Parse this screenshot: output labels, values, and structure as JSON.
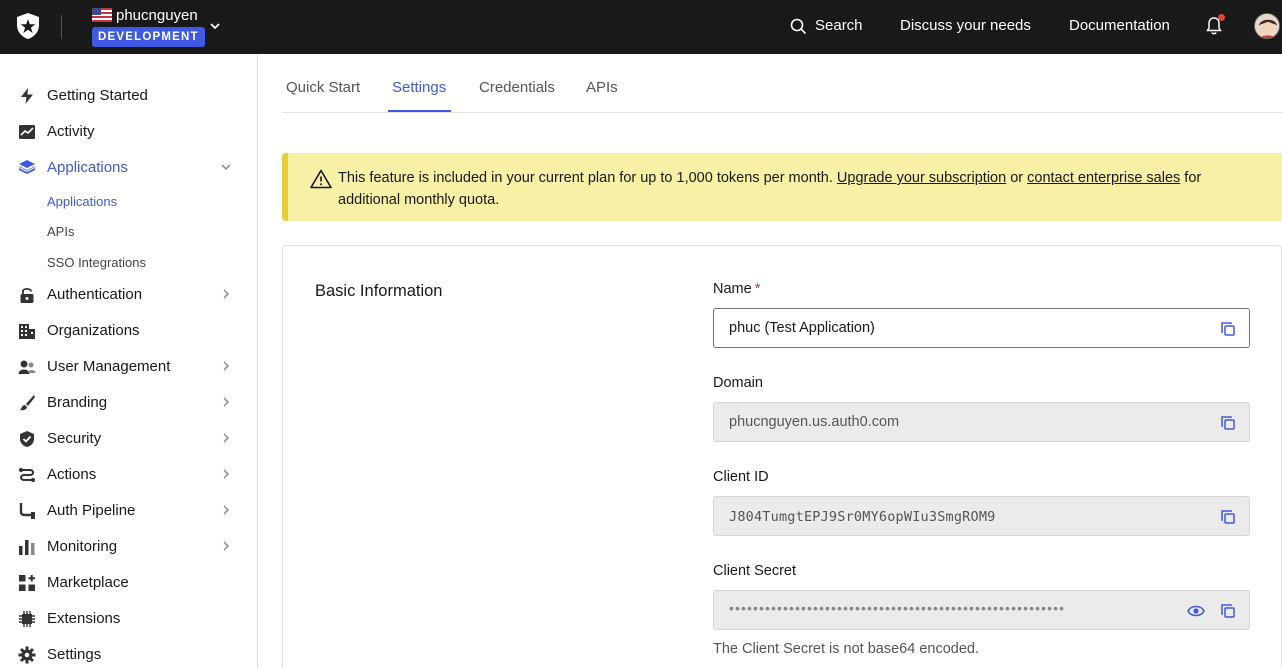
{
  "topbar": {
    "tenant_name": "phucnguyen",
    "env_badge": "DEVELOPMENT",
    "search_label": "Search",
    "discuss_label": "Discuss your needs",
    "docs_label": "Documentation"
  },
  "sidebar": {
    "items": [
      {
        "label": "Getting Started",
        "icon": "bolt-icon"
      },
      {
        "label": "Activity",
        "icon": "activity-chart-icon"
      },
      {
        "label": "Applications",
        "icon": "layers-icon"
      },
      {
        "label": "Authentication",
        "icon": "lock-icon"
      },
      {
        "label": "Organizations",
        "icon": "building-icon"
      },
      {
        "label": "User Management",
        "icon": "users-icon"
      },
      {
        "label": "Branding",
        "icon": "brush-icon"
      },
      {
        "label": "Security",
        "icon": "shield-check-icon"
      },
      {
        "label": "Actions",
        "icon": "flow-icon"
      },
      {
        "label": "Auth Pipeline",
        "icon": "pipeline-icon"
      },
      {
        "label": "Monitoring",
        "icon": "bar-chart-icon"
      },
      {
        "label": "Marketplace",
        "icon": "grid-plus-icon"
      },
      {
        "label": "Extensions",
        "icon": "chip-icon"
      },
      {
        "label": "Settings",
        "icon": "gear-icon"
      }
    ],
    "sub_items": [
      {
        "label": "Applications"
      },
      {
        "label": "APIs"
      },
      {
        "label": "SSO Integrations"
      }
    ]
  },
  "tabs": [
    {
      "label": "Quick Start"
    },
    {
      "label": "Settings"
    },
    {
      "label": "Credentials"
    },
    {
      "label": "APIs"
    }
  ],
  "banner": {
    "text_before": "This feature is included in your current plan for up to 1,000 tokens per month. ",
    "link1": "Upgrade your subscription",
    "text_mid": " or ",
    "link2": "contact enterprise sales",
    "text_after": " for additional monthly quota."
  },
  "basic_info": {
    "section_title": "Basic Information",
    "name_label": "Name",
    "name_value": "phuc (Test Application)",
    "domain_label": "Domain",
    "domain_value": "phucnguyen.us.auth0.com",
    "client_id_label": "Client ID",
    "client_id_value": "J804TumgtEPJ9Sr0MY6opWIu3SmgROM9",
    "client_secret_label": "Client Secret",
    "client_secret_masked": "••••••••••••••••••••••••••••••••••••••••••••••••••••••••",
    "client_secret_hint": "The Client Secret is not base64 encoded."
  },
  "colors": {
    "accent": "#3f59e4",
    "topbar_bg": "#191919",
    "banner_bg": "#f7f0a5",
    "banner_border": "#e8cf3a",
    "required": "#d0312d"
  }
}
